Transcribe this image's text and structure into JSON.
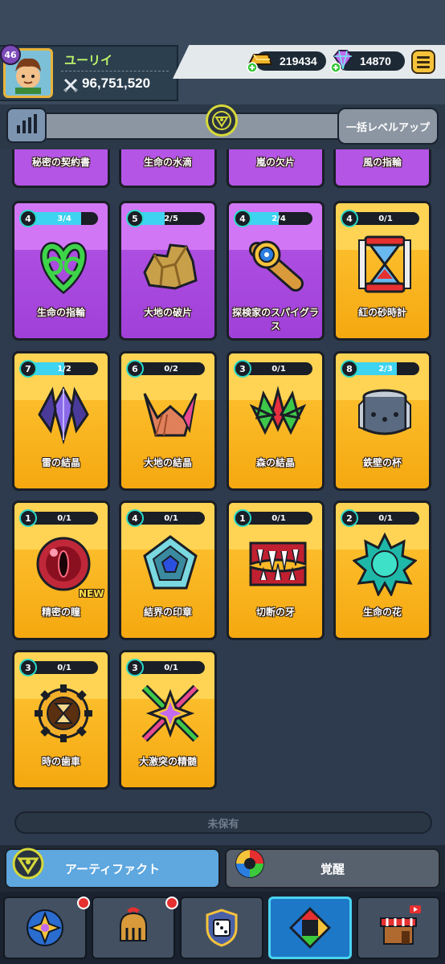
{
  "player": {
    "level": "46",
    "name": "ユーリイ",
    "power": "96,751,520"
  },
  "currency": {
    "gold": "219434",
    "gems": "14870"
  },
  "toolbar": {
    "bulk_level_up": "一括レベルアップ"
  },
  "top_row": [
    {
      "label": "秘密の契約書"
    },
    {
      "label": "生命の水滴"
    },
    {
      "label": "嵐の欠片"
    },
    {
      "label": "風の指輪"
    }
  ],
  "cards": [
    {
      "label": "生命の指輪",
      "level": "4",
      "progress": "3/4",
      "fill": 0.75,
      "rarity": "purple",
      "icon": "heart-knot-icon"
    },
    {
      "label": "大地の破片",
      "level": "5",
      "progress": "2/5",
      "fill": 0.4,
      "rarity": "purple",
      "icon": "rock-shard-icon"
    },
    {
      "label": "探検家のスパイグラス",
      "level": "4",
      "progress": "2/4",
      "fill": 0.5,
      "rarity": "purple",
      "icon": "spyglass-icon"
    },
    {
      "label": "紅の砂時計",
      "level": "4",
      "progress": "0/1",
      "fill": 0,
      "rarity": "gold",
      "icon": "hourglass-icon"
    },
    {
      "label": "雷の結晶",
      "level": "7",
      "progress": "1/2",
      "fill": 0.5,
      "rarity": "gold",
      "icon": "thunder-crystal-icon"
    },
    {
      "label": "大地の結晶",
      "level": "6",
      "progress": "0/2",
      "fill": 0,
      "rarity": "gold",
      "icon": "earth-crystal-icon"
    },
    {
      "label": "森の結晶",
      "level": "3",
      "progress": "0/1",
      "fill": 0,
      "rarity": "gold",
      "icon": "forest-crystal-icon"
    },
    {
      "label": "鉄壁の杯",
      "level": "8",
      "progress": "2/3",
      "fill": 0.67,
      "rarity": "gold",
      "icon": "iron-cup-icon"
    },
    {
      "label": "精密の瞳",
      "level": "1",
      "progress": "0/1",
      "fill": 0,
      "rarity": "gold",
      "icon": "precision-eye-icon",
      "new": "NEW"
    },
    {
      "label": "結界の印章",
      "level": "4",
      "progress": "0/1",
      "fill": 0,
      "rarity": "gold",
      "icon": "barrier-seal-icon"
    },
    {
      "label": "切断の牙",
      "level": "1",
      "progress": "0/1",
      "fill": 0,
      "rarity": "gold",
      "icon": "fang-icon"
    },
    {
      "label": "生命の花",
      "level": "2",
      "progress": "0/1",
      "fill": 0,
      "rarity": "gold",
      "icon": "life-flower-icon"
    },
    {
      "label": "時の歯車",
      "level": "3",
      "progress": "0/1",
      "fill": 0,
      "rarity": "gold",
      "icon": "time-gear-icon"
    },
    {
      "label": "大激突の精髄",
      "level": "3",
      "progress": "0/1",
      "fill": 0,
      "rarity": "gold",
      "icon": "clash-essence-icon"
    }
  ],
  "unowned_label": "未保有",
  "subtabs": {
    "artifact": "アーティファクト",
    "awaken": "覚醒"
  },
  "nav": [
    {
      "icon": "star-gem-icon",
      "badge": true
    },
    {
      "icon": "helmet-icon",
      "badge": true
    },
    {
      "icon": "dice-shield-icon",
      "badge": false
    },
    {
      "icon": "arrows-diamond-icon",
      "badge": false,
      "active": true
    },
    {
      "icon": "shop-icon",
      "badge": false
    }
  ]
}
